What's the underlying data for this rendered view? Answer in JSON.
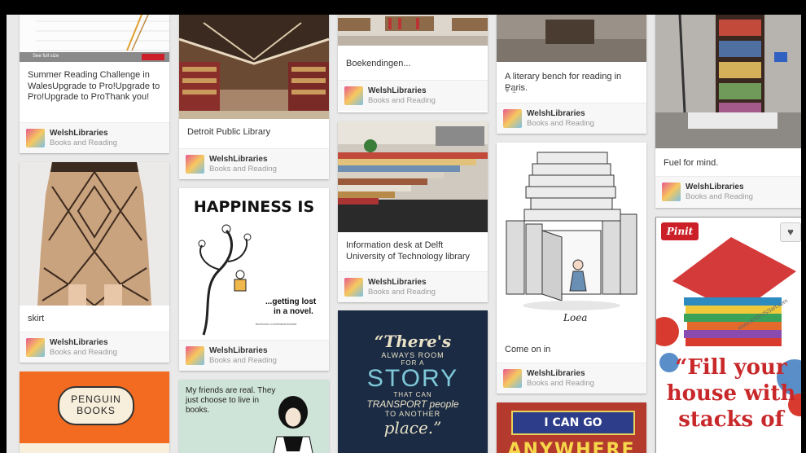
{
  "pins": {
    "summer": {
      "chart_link": "See full size",
      "desc": "Summer Reading Challenge in WalesUpgrade to Pro!Upgrade to Pro!Upgrade to ProThank you!",
      "user": "WelshLibraries",
      "board": "Books and Reading"
    },
    "skirt": {
      "desc": "skirt",
      "user": "WelshLibraries",
      "board": "Books and Reading"
    },
    "penguin": {
      "logo_line1": "PENGUIN",
      "logo_line2": "BOOKS"
    },
    "detroit": {
      "desc": "Detroit Public Library",
      "user": "WelshLibraries",
      "board": "Books and Reading"
    },
    "happiness": {
      "title": "HAPPINESS IS",
      "caption_line1": "...getting lost",
      "caption_line2": "in a novel.",
      "credit": "facebook.com/lesfashionista",
      "user": "WelshLibraries",
      "board": "Books and Reading"
    },
    "friends": {
      "text": "My friends are real. They just choose to live in books."
    },
    "bookends": {
      "desc": "Boekendingen...",
      "user": "WelshLibraries",
      "board": "Books and Reading"
    },
    "delft": {
      "desc": "Information desk at Delft University of Technology library",
      "user": "WelshLibraries",
      "board": "Books and Reading"
    },
    "story": {
      "line1": "“There's",
      "line2": "ALWAYS ROOM",
      "line3": "FOR A",
      "line4": "STORY",
      "line5": "THAT CAN",
      "line6": "TRANSPORT people",
      "line7": "TO ANOTHER",
      "line8": "place.”"
    },
    "paris": {
      "desc": "A literary bench for reading in Paris.",
      "repins": "1",
      "user": "WelshLibraries",
      "board": "Books and Reading"
    },
    "comeon": {
      "desc": "Come on in",
      "signature": "Loea",
      "user": "WelshLibraries",
      "board": "Books and Reading"
    },
    "icango": {
      "line1": "I CAN GO",
      "line2": "ANYWHERE"
    },
    "fuel": {
      "desc": "Fuel for mind.",
      "user": "WelshLibraries",
      "board": "Books and Reading"
    },
    "fill": {
      "pinit": "Pinit",
      "watermark": "www.drSEUSSart.com",
      "line1": "“Fill your",
      "line2": "house with",
      "line3": "stacks of"
    }
  },
  "colors": {
    "pinit_red": "#cb2027",
    "board_bg": "#e9e9e9",
    "penguin_orange": "#f26b21",
    "story_navy": "#1b2b44"
  }
}
